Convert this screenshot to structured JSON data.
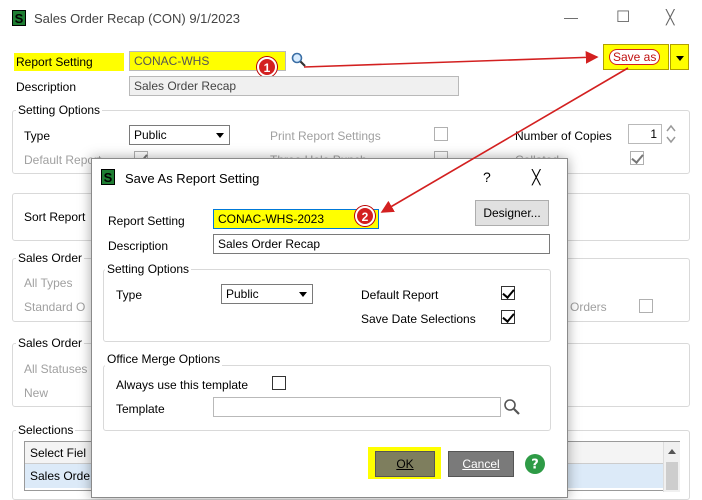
{
  "window": {
    "title": "Sales Order Recap (CON) 9/1/2023",
    "controls": {
      "minimize": "—",
      "maximize": "☐",
      "close": "╳"
    }
  },
  "main": {
    "report_setting_label": "Report Setting",
    "report_setting_value": "CONAC-WHS",
    "description_label": "Description",
    "description_value": "Sales Order Recap",
    "save_as_label": "Save as",
    "setting_options_title": "Setting Options",
    "type_label": "Type",
    "type_value": "Public",
    "default_report_label": "Default Report",
    "print_report_settings_label": "Print Report Settings",
    "three_hole_punch_label": "Three Hole Punch",
    "number_of_copies_label": "Number of Copies",
    "number_of_copies_value": "1",
    "collated_label": "Collated",
    "sort_report_label": "Sort Report",
    "sales_order_group1": "Sales Order",
    "all_types_label": "All Types",
    "standard_label": "Standard O",
    "orders_label": "Orders",
    "sales_order_group2": "Sales Order",
    "all_statuses_label": "All Statuses",
    "new_label": "New",
    "selections_title": "Selections",
    "select_field_header": "Select Fiel",
    "sales_order_row": "Sales Orde"
  },
  "dialog": {
    "title": "Save As Report Setting",
    "help_glyph": "?",
    "close_glyph": "╳",
    "report_setting_label": "Report Setting",
    "report_setting_value": "CONAC-WHS-2023",
    "designer_label": "Designer...",
    "description_label": "Description",
    "description_value": "Sales Order Recap",
    "setting_options_title": "Setting Options",
    "type_label": "Type",
    "type_value": "Public",
    "default_report_label": "Default Report",
    "save_date_selections_label": "Save Date Selections",
    "office_merge_title": "Office Merge Options",
    "always_use_template_label": "Always use this template",
    "template_label": "Template",
    "template_value": "",
    "ok_label": "OK",
    "cancel_label": "Cancel"
  },
  "annotations": {
    "badge1": "1",
    "badge2": "2",
    "arrow_color": "#d32020",
    "highlight_color": "#ffff00"
  }
}
